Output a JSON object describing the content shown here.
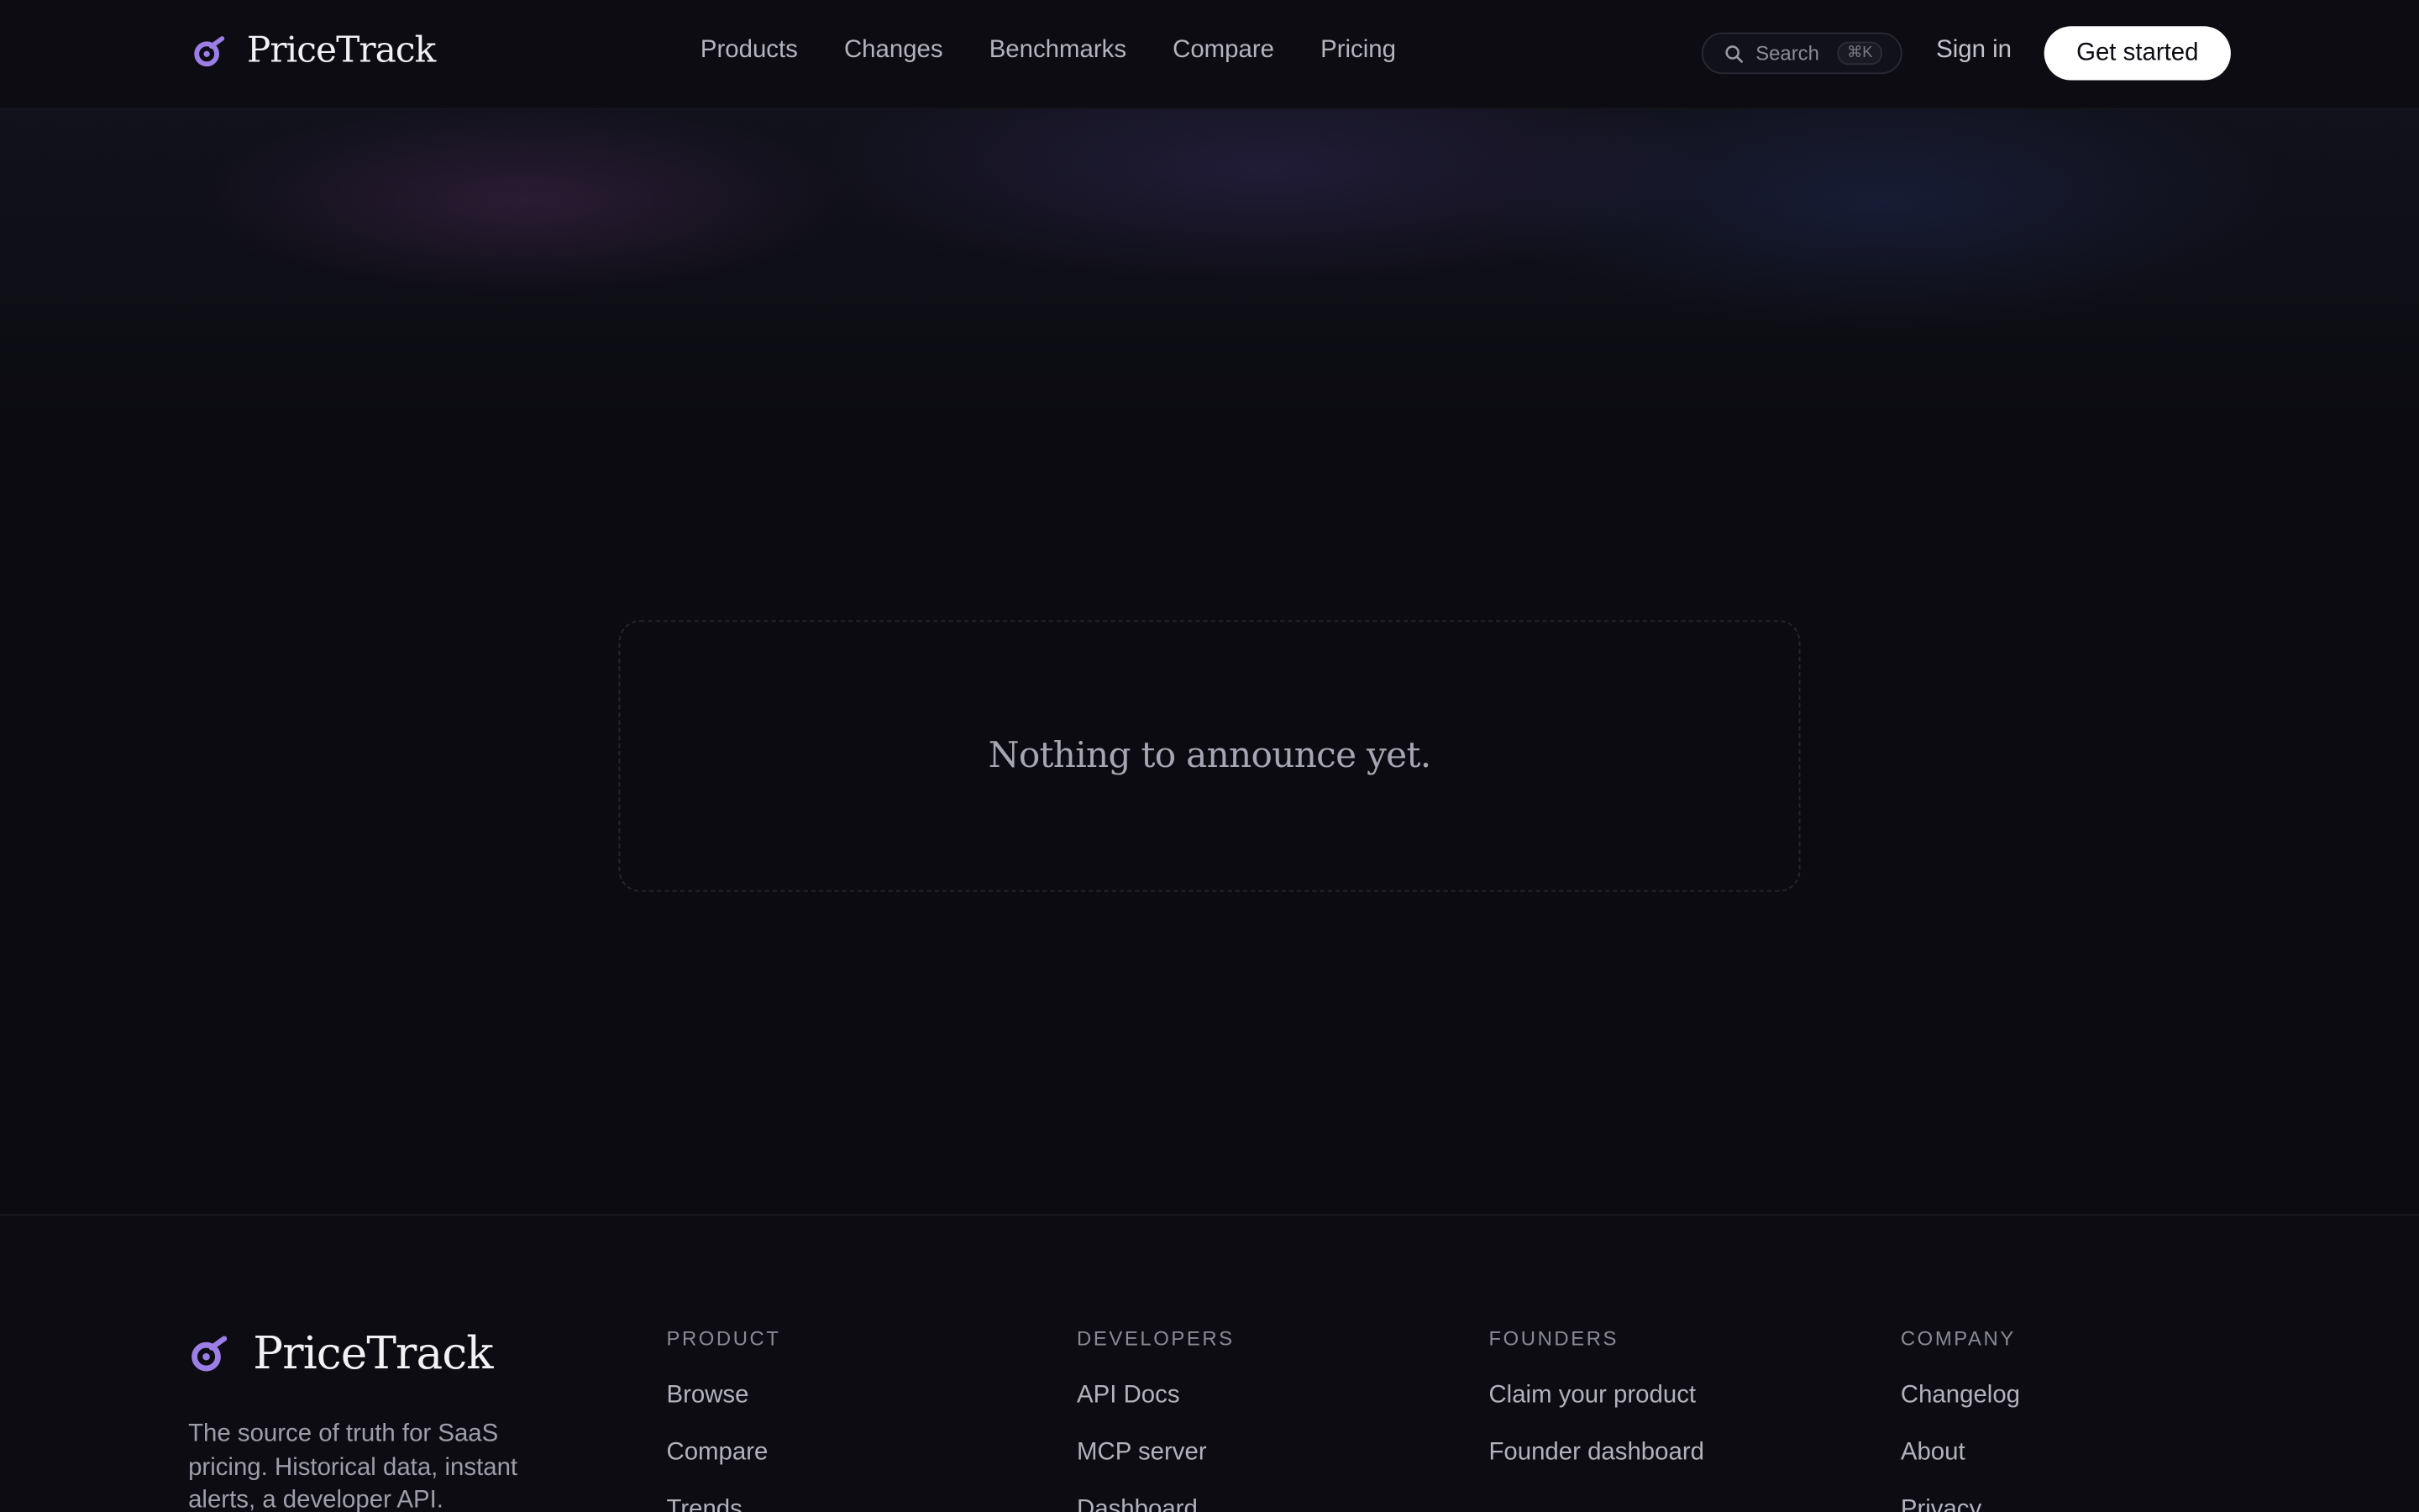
{
  "brand": {
    "name": "PriceTrack",
    "accent": "#9b7fe6"
  },
  "nav": {
    "links": [
      "Products",
      "Changes",
      "Benchmarks",
      "Compare",
      "Pricing"
    ],
    "search_label": "Search",
    "search_shortcut": "⌘K",
    "signin": "Sign in",
    "cta": "Get started"
  },
  "main": {
    "empty_message": "Nothing to announce yet."
  },
  "footer": {
    "tagline": "The source of truth for SaaS pricing. Historical data, instant alerts, a developer API.",
    "columns": [
      {
        "heading": "PRODUCT",
        "items": [
          "Browse",
          "Compare",
          "Trends"
        ]
      },
      {
        "heading": "DEVELOPERS",
        "items": [
          "API Docs",
          "MCP server",
          "Dashboard"
        ]
      },
      {
        "heading": "FOUNDERS",
        "items": [
          "Claim your product",
          "Founder dashboard"
        ]
      },
      {
        "heading": "COMPANY",
        "items": [
          "Changelog",
          "About",
          "Privacy"
        ]
      }
    ]
  }
}
